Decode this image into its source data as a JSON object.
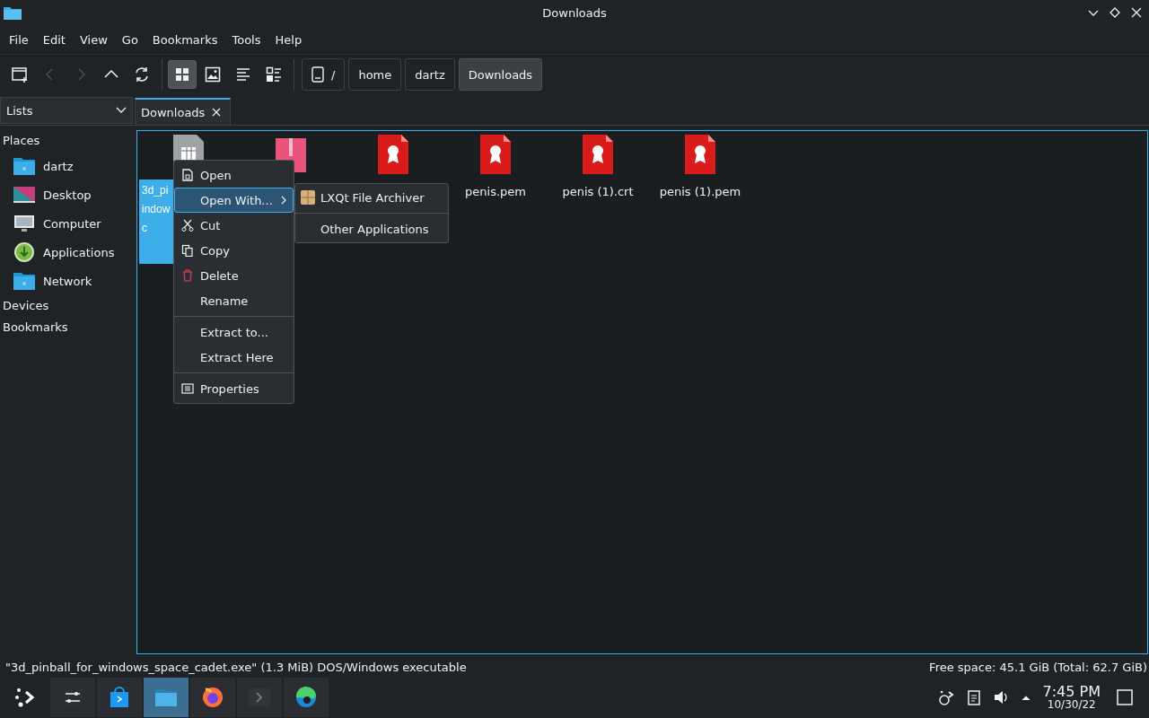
{
  "window": {
    "title": "Downloads"
  },
  "menu_bar": [
    "File",
    "Edit",
    "View",
    "Go",
    "Bookmarks",
    "Tools",
    "Help"
  ],
  "toolbar": {
    "tools": [
      {
        "kind": "new-window",
        "disabled": false,
        "selected": false
      },
      {
        "kind": "back",
        "disabled": true,
        "selected": false
      },
      {
        "kind": "forward",
        "disabled": true,
        "selected": false
      },
      {
        "kind": "up",
        "disabled": false,
        "selected": false
      },
      {
        "kind": "reload",
        "disabled": false,
        "selected": false
      },
      {
        "kind": "icon-view",
        "disabled": false,
        "selected": true
      },
      {
        "kind": "thumbnail-view",
        "disabled": false,
        "selected": false
      },
      {
        "kind": "compact-view",
        "disabled": false,
        "selected": false
      },
      {
        "kind": "detail-view",
        "disabled": false,
        "selected": false
      }
    ],
    "path": [
      {
        "label": "/",
        "selected": false
      },
      {
        "label": "home",
        "selected": false
      },
      {
        "label": "dartz",
        "selected": false
      },
      {
        "label": "Downloads",
        "selected": true
      }
    ]
  },
  "side_pane_mode": {
    "value": "Lists"
  },
  "tabs": [
    {
      "label": "Downloads",
      "selected": true
    }
  ],
  "sidebar": {
    "sections": [
      {
        "label": "Places",
        "items": [
          {
            "label": "dartz",
            "kind": "home"
          },
          {
            "label": "Desktop",
            "kind": "desktop"
          },
          {
            "label": "Computer",
            "kind": "computer"
          },
          {
            "label": "Applications",
            "kind": "applications"
          },
          {
            "label": "Network",
            "kind": "network"
          }
        ]
      },
      {
        "label": "Devices"
      },
      {
        "label": "Bookmarks"
      }
    ]
  },
  "files": [
    {
      "kind": "executable",
      "selected": true,
      "label_lines": [
        "3d_pi",
        "indow",
        "c"
      ]
    },
    {
      "kind": "archive",
      "selected": false
    },
    {
      "kind": "certificate",
      "selected": false
    },
    {
      "kind": "certificate",
      "selected": false,
      "label_lines": [
        "penis.pem"
      ]
    },
    {
      "kind": "certificate",
      "selected": false,
      "label_lines": [
        "penis (1).crt"
      ]
    },
    {
      "kind": "certificate",
      "selected": false,
      "label_lines": [
        "penis (1).pem"
      ]
    }
  ],
  "context_menu": {
    "groups": [
      [
        {
          "label": "Open",
          "kind": "open",
          "selected": false,
          "submenu": false
        },
        {
          "label": "Open With...",
          "kind": "open-with",
          "selected": true,
          "submenu": true
        },
        {
          "label": "Cut",
          "kind": "cut",
          "selected": false,
          "submenu": false
        },
        {
          "label": "Copy",
          "kind": "copy",
          "selected": false,
          "submenu": false
        },
        {
          "label": "Delete",
          "kind": "delete",
          "selected": false,
          "submenu": false
        },
        {
          "label": "Rename",
          "kind": "rename",
          "selected": false,
          "submenu": false
        }
      ],
      [
        {
          "label": "Extract to...",
          "kind": "extract-to",
          "selected": false,
          "submenu": false
        },
        {
          "label": "Extract Here",
          "kind": "extract-here",
          "selected": false,
          "submenu": false
        }
      ],
      [
        {
          "label": "Properties",
          "kind": "properties",
          "selected": false,
          "submenu": false
        }
      ]
    ]
  },
  "submenu": [
    {
      "label": "LXQt File Archiver",
      "kind": "application"
    },
    {
      "label": "Other Applications",
      "kind": "other"
    }
  ],
  "status_bar": {
    "selection": "\"3d_pinball_for_windows_space_cadet.exe\" (1.3 MiB) DOS/Windows executable",
    "free_space": "Free space: 45.1 GiB (Total: 62.7 GiB)"
  },
  "taskbar": {
    "apps": [
      {
        "kind": "launcher",
        "selected": false
      },
      {
        "kind": "settings",
        "selected": false
      },
      {
        "kind": "store",
        "selected": false
      },
      {
        "kind": "files",
        "selected": true
      },
      {
        "kind": "browser",
        "selected": false
      },
      {
        "kind": "terminal",
        "selected": false
      },
      {
        "kind": "edge",
        "selected": false
      }
    ],
    "time": "7:45 PM",
    "date": "10/30/22"
  }
}
